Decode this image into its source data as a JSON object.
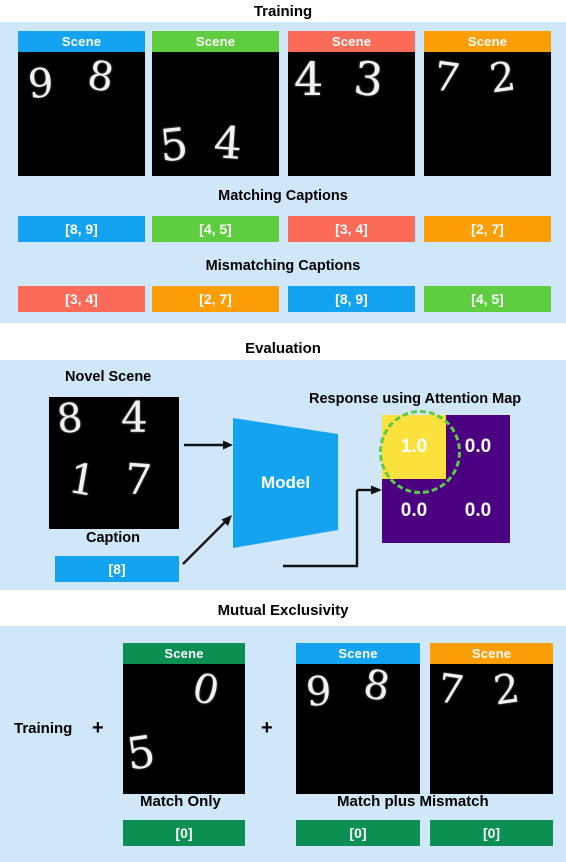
{
  "colors": {
    "panel_bg": "#cfe7f9",
    "blue": "#13a3f0",
    "green": "#5ecd3f",
    "salmon": "#fc6a58",
    "orange": "#fb9e07",
    "dark_green": "#0b8f52",
    "purple": "#4b0082",
    "yellow": "#fbe13c",
    "ring_green": "#5ec946",
    "scene_black": "#000000",
    "text_black": "#000000",
    "white": "#ffffff"
  },
  "sections": {
    "training": {
      "title": "Training"
    },
    "evaluation": {
      "title": "Evaluation"
    },
    "mutual_exclusivity": {
      "title": "Mutual Exclusivity"
    }
  },
  "training": {
    "scene_label": "Scene",
    "matching_label": "Matching Captions",
    "mismatching_label": "Mismatching Captions",
    "scenes": [
      {
        "color": "#13a3f0",
        "header": "Scene",
        "digits": [
          "9",
          "8"
        ]
      },
      {
        "color": "#5ecd3f",
        "header": "Scene",
        "digits": [
          "5",
          "4"
        ]
      },
      {
        "color": "#fc6a58",
        "header": "Scene",
        "digits": [
          "4",
          "3"
        ]
      },
      {
        "color": "#fb9e07",
        "header": "Scene",
        "digits": [
          "7",
          "2"
        ]
      }
    ],
    "matching_captions": [
      {
        "text": "[8, 9]",
        "color": "#13a3f0"
      },
      {
        "text": "[4, 5]",
        "color": "#5ecd3f"
      },
      {
        "text": "[3, 4]",
        "color": "#fc6a58"
      },
      {
        "text": "[2, 7]",
        "color": "#fb9e07"
      }
    ],
    "mismatching_captions": [
      {
        "text": "[3, 4]",
        "color": "#fc6a58"
      },
      {
        "text": "[2, 7]",
        "color": "#fb9e07"
      },
      {
        "text": "[8, 9]",
        "color": "#13a3f0"
      },
      {
        "text": "[4, 5]",
        "color": "#5ecd3f"
      }
    ]
  },
  "evaluation": {
    "novel_scene_label": "Novel Scene",
    "caption_label": "Caption",
    "caption_value": "[8]",
    "model_label": "Model",
    "response_label": "Response using Attention Map",
    "novel_scene_digits": [
      "8",
      "4",
      "1",
      "7"
    ],
    "attention_map": {
      "rows": 2,
      "cols": 2,
      "values": [
        [
          "1.0",
          "0.0"
        ],
        [
          "0.0",
          "0.0"
        ]
      ],
      "highlighted": [
        0,
        0
      ],
      "hot_color": "#fbe13c",
      "cold_color": "#4b0082"
    }
  },
  "mutual_exclusivity": {
    "training_label": "Training",
    "plus_1": "+",
    "plus_2": "+",
    "match_only_label": "Match Only",
    "match_plus_mismatch_label": "Match plus Mismatch",
    "scene_label": "Scene",
    "scenes": [
      {
        "color": "#0b8f52",
        "header": "Scene",
        "digits": [
          "5",
          "0"
        ],
        "caption": "[0]",
        "caption_color": "#0b8f52"
      },
      {
        "color": "#13a3f0",
        "header": "Scene",
        "digits": [
          "9",
          "8"
        ],
        "caption": "[0]",
        "caption_color": "#0b8f52"
      },
      {
        "color": "#fb9e07",
        "header": "Scene",
        "digits": [
          "7",
          "2"
        ],
        "caption": "[0]",
        "caption_color": "#0b8f52"
      }
    ]
  }
}
